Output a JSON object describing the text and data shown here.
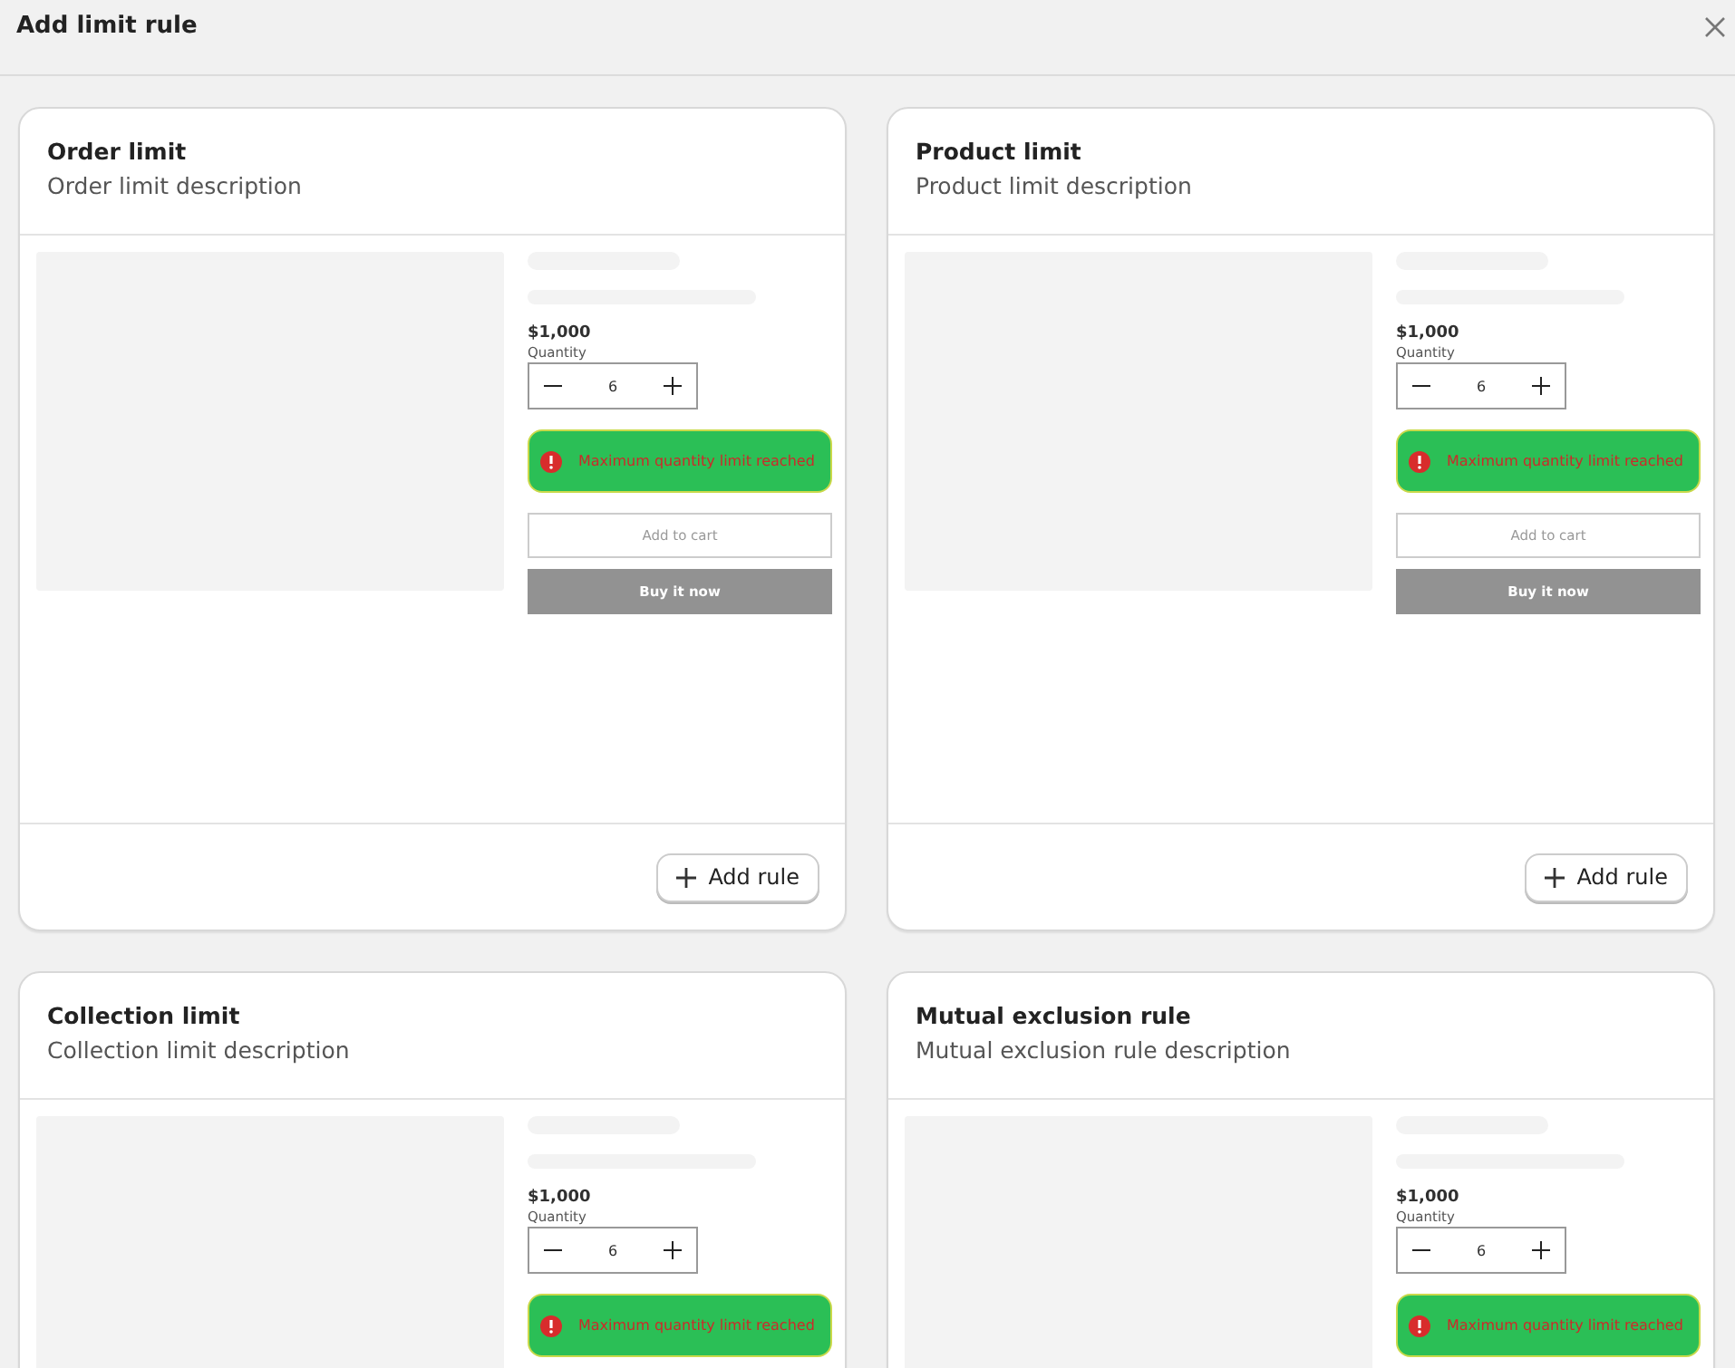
{
  "dialog": {
    "title": "Add limit rule"
  },
  "cards": [
    {
      "title": "Order limit",
      "description": "Order limit description",
      "price": "$1,000",
      "quantity_label": "Quantity",
      "quantity": "6",
      "message": "Maximum quantity limit reached",
      "add_to_cart": "Add to cart",
      "buy_now": "Buy it now",
      "add_rule": "Add rule"
    },
    {
      "title": "Product limit",
      "description": "Product limit description",
      "price": "$1,000",
      "quantity_label": "Quantity",
      "quantity": "6",
      "message": "Maximum quantity limit reached",
      "add_to_cart": "Add to cart",
      "buy_now": "Buy it now",
      "add_rule": "Add rule"
    },
    {
      "title": "Collection limit",
      "description": "Collection limit description",
      "price": "$1,000",
      "quantity_label": "Quantity",
      "quantity": "6",
      "message": "Maximum quantity limit reached"
    },
    {
      "title": "Mutual exclusion rule",
      "description": "Mutual exclusion rule description",
      "price": "$1,000",
      "quantity_label": "Quantity",
      "quantity": "6",
      "message": "Maximum quantity limit reached"
    }
  ]
}
